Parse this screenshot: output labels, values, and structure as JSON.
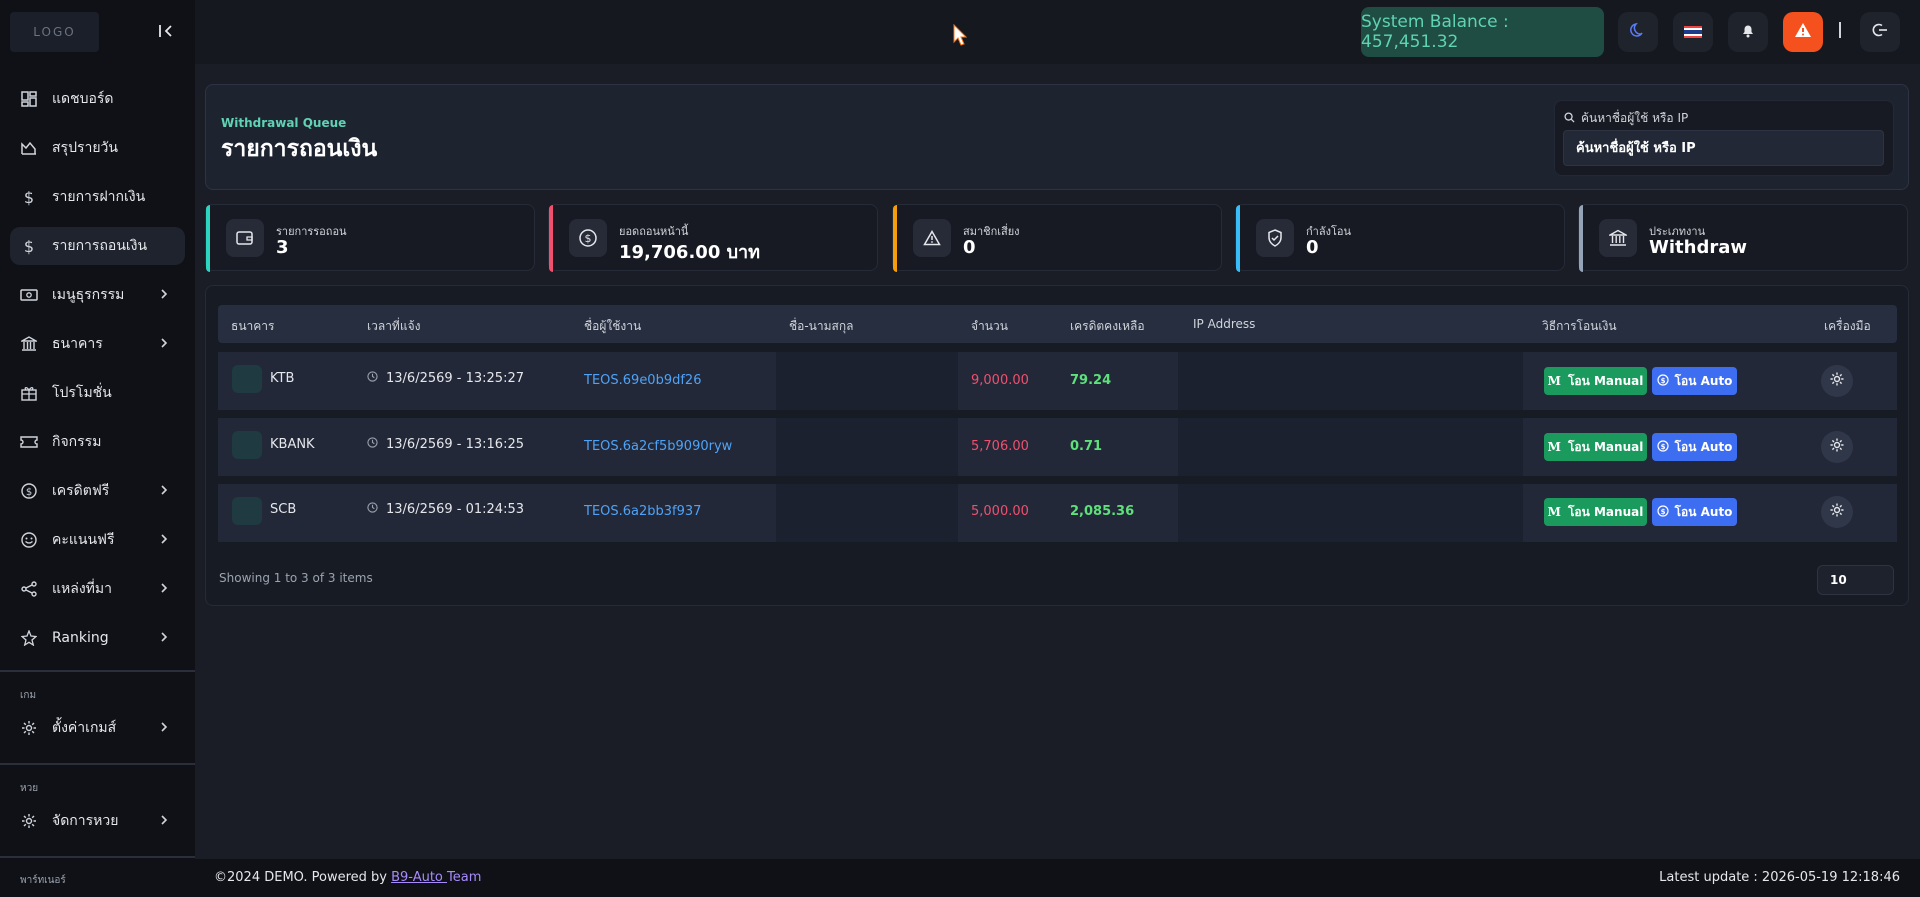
{
  "sidebar": {
    "logo": "LOGO",
    "items": [
      {
        "label": "แดชบอร์ด",
        "icon": "dashboard-icon"
      },
      {
        "label": "สรุปรายวัน",
        "icon": "chart-area-icon"
      },
      {
        "label": "รายการฝากเงิน",
        "icon": "dollar-icon"
      },
      {
        "label": "รายการถอนเงิน",
        "icon": "dollar-icon"
      },
      {
        "label": "เมนูธุรกรรม",
        "icon": "cash-icon"
      },
      {
        "label": "ธนาคาร",
        "icon": "bank-icon"
      },
      {
        "label": "โปรโมชั่น",
        "icon": "gift-icon"
      },
      {
        "label": "กิจกรรม",
        "icon": "ticket-icon"
      },
      {
        "label": "เครดิตฟรี",
        "icon": "coin-icon"
      },
      {
        "label": "คะแนนฟรี",
        "icon": "smile-icon"
      },
      {
        "label": "แหล่งที่มา",
        "icon": "share-icon"
      },
      {
        "label": "Ranking",
        "icon": "star-icon"
      }
    ],
    "section_game": "เกม",
    "game_settings": "ตั้งค่าเกมส์",
    "section_lotto": "หวย",
    "lotto_manage": "จัดการหวย",
    "section_partner": "พาร์ทเนอร์"
  },
  "topbar": {
    "balance": "System Balance : 457,451.32"
  },
  "header": {
    "subtitle": "Withdrawal Queue",
    "title": "รายการถอนเงิน",
    "search_label": "ค้นหาชื่อผู้ใช้ หรือ IP",
    "search_placeholder": "ค้นหาชื่อผู้ใช้ หรือ IP"
  },
  "stats": [
    {
      "label": "รายการรอถอน",
      "value": "3",
      "color": "#2dd4bf",
      "icon": "wallet-icon"
    },
    {
      "label": "ยอดถอนหน้านี้",
      "value": "19,706.00 บาท",
      "color": "#f0506e",
      "icon": "dollar-circle-icon"
    },
    {
      "label": "สมาชิกเสี่ยง",
      "value": "0",
      "color": "#f59e0b",
      "icon": "warning-icon"
    },
    {
      "label": "กำลังโอน",
      "value": "0",
      "color": "#38bdf8",
      "icon": "shield-check-icon"
    },
    {
      "label": "ประเภทงาน",
      "value": "Withdraw",
      "color": "#94a3b8",
      "icon": "bank-icon"
    }
  ],
  "table": {
    "headers": [
      "ธนาคาร",
      "เวลาที่แจ้ง",
      "ชื่อผู้ใช้งาน",
      "ชื่อ-นามสกุล",
      "จำนวน",
      "เครดิตคงเหลือ",
      "IP Address",
      "วิธีการโอนเงิน",
      "เครื่องมือ"
    ],
    "rows": [
      {
        "bank": "KTB",
        "time": "13/6/2569 - 13:25:27",
        "user": "TEOS.69e0b9df26",
        "amount": "9,000.00",
        "credit": "79.24"
      },
      {
        "bank": "KBANK",
        "time": "13/6/2569 - 13:16:25",
        "user": "TEOS.6a2cf5b9090ryw",
        "amount": "5,706.00",
        "credit": "0.71"
      },
      {
        "bank": "SCB",
        "time": "13/6/2569 - 01:24:53",
        "user": "TEOS.6a2bb3f937",
        "amount": "5,000.00",
        "credit": "2,085.36"
      }
    ],
    "btn_manual": "โอน Manual",
    "btn_auto": "โอน Auto",
    "showing": "Showing 1 to 3 of 3 items",
    "page_size": "10"
  },
  "footer": {
    "left_prefix": "©2024 DEMO. Powered by ",
    "link": "B9-Auto ",
    "team": "Team",
    "right": "Latest update : 2026-05-19 12:18:46"
  }
}
